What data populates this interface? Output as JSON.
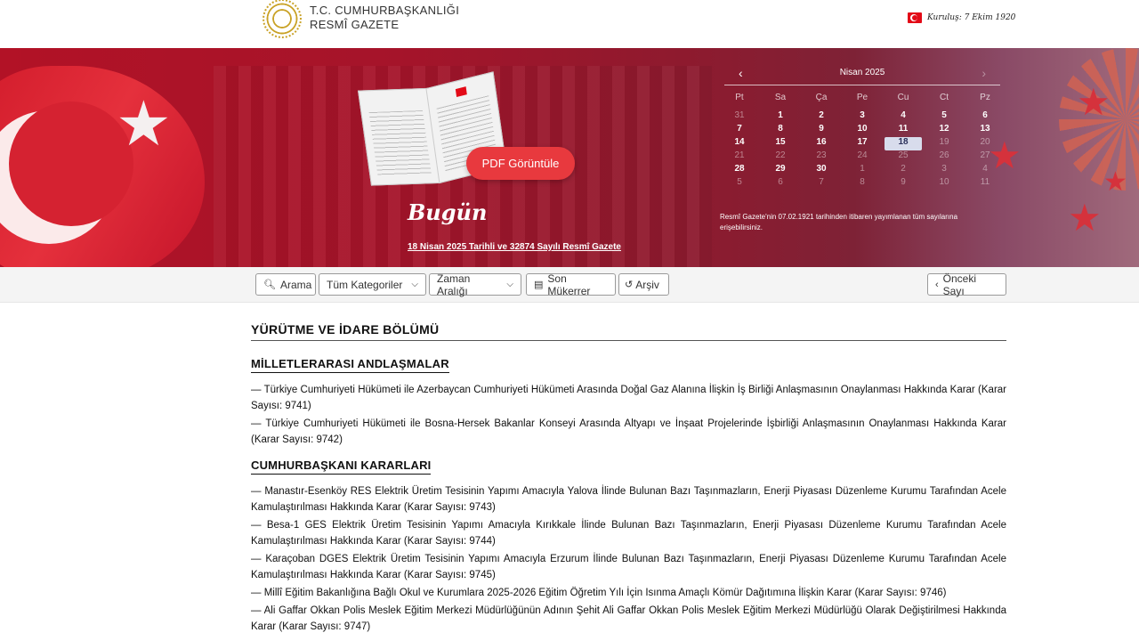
{
  "header": {
    "logo_line1": "T.C. CUMHURBAŞKANLIĞI",
    "logo_line2": "RESMÎ GAZETE",
    "founding_text": "Kuruluş: 7 Ekim 1920"
  },
  "hero": {
    "pdf_button": "PDF Görüntüle",
    "today_label": "Bugün",
    "today_link": "18 Nisan 2025 Tarihli ve 32874 Sayılı Resmî Gazete",
    "calendar": {
      "title": "Nisan 2025",
      "prev": "‹",
      "next": "›",
      "weekdays": [
        "Pt",
        "Sa",
        "Ça",
        "Pe",
        "Cu",
        "Ct",
        "Pz"
      ],
      "rows": [
        [
          "31",
          "1",
          "2",
          "3",
          "4",
          "5",
          "6"
        ],
        [
          "7",
          "8",
          "9",
          "10",
          "11",
          "12",
          "13"
        ],
        [
          "14",
          "15",
          "16",
          "17",
          "18",
          "19",
          "20"
        ],
        [
          "21",
          "22",
          "23",
          "24",
          "25",
          "26",
          "27"
        ],
        [
          "28",
          "29",
          "30",
          "1",
          "2",
          "3",
          "4"
        ],
        [
          "5",
          "6",
          "7",
          "8",
          "9",
          "10",
          "11"
        ]
      ],
      "selected": "18"
    },
    "calendar_note": "Resmî Gazete'nin 07.02.1921 tarihinden itibaren yayımlanan tüm sayılarına erişebilirsiniz."
  },
  "toolbar": {
    "search": "Arama",
    "categories": "Tüm Kategoriler",
    "date_range": "Zaman Aralığı",
    "last_repeat": "Son Mükerrer",
    "archive": "Arşiv",
    "previous": "Önceki Sayı"
  },
  "content": {
    "section_title": "YÜRÜTME VE İDARE BÖLÜMÜ",
    "groups": [
      {
        "title": "MİLLETLERARASI ANDLAŞMALAR",
        "items": [
          "— Türkiye Cumhuriyeti Hükümeti ile Azerbaycan Cumhuriyeti Hükümeti Arasında Doğal Gaz Alanına İlişkin İş Birliği Anlaşmasının Onaylanması Hakkında Karar (Karar Sayısı: 9741)",
          "— Türkiye Cumhuriyeti Hükümeti ile Bosna-Hersek Bakanlar Konseyi Arasında Altyapı ve İnşaat Projelerinde İşbirliği Anlaşmasının Onaylanması Hakkında Karar (Karar Sayısı: 9742)"
        ]
      },
      {
        "title": "CUMHURBAŞKANI KARARLARI",
        "items": [
          "— Manastır-Esenköy RES Elektrik Üretim Tesisinin Yapımı Amacıyla Yalova İlinde Bulunan Bazı Taşınmazların, Enerji Piyasası Düzenleme Kurumu Tarafından Acele Kamulaştırılması Hakkında Karar (Karar Sayısı: 9743)",
          "— Besa-1 GES Elektrik Üretim Tesisinin Yapımı Amacıyla Kırıkkale İlinde Bulunan Bazı Taşınmazların, Enerji Piyasası Düzenleme Kurumu Tarafından Acele Kamulaştırılması Hakkında Karar (Karar Sayısı: 9744)",
          "— Karaçoban DGES Elektrik Üretim Tesisinin Yapımı Amacıyla Erzurum İlinde Bulunan Bazı Taşınmazların, Enerji Piyasası Düzenleme Kurumu Tarafından Acele Kamulaştırılması Hakkında Karar (Karar Sayısı: 9745)",
          "— Millî Eğitim Bakanlığına Bağlı Okul ve Kurumlara 2025-2026 Eğitim Öğretim Yılı İçin Isınma Amaçlı Kömür Dağıtımına İlişkin Karar (Karar Sayısı: 9746)",
          "— Ali Gaffar Okkan Polis Meslek Eğitim Merkezi Müdürlüğünün Adının Şehit Ali Gaffar Okkan Polis Meslek Eğitim Merkezi Müdürlüğü Olarak Değiştirilmesi Hakkında Karar (Karar Sayısı: 9747)"
        ]
      }
    ]
  }
}
